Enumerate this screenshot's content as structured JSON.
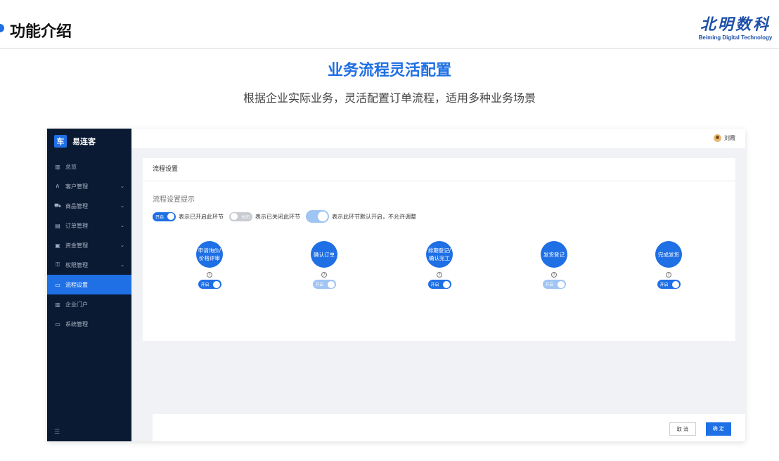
{
  "slide": {
    "section_title": "功能介绍",
    "logo_cn": "北明数科",
    "logo_en": "Beiming Digital Technology",
    "headline": "业务流程灵活配置",
    "subline": "根据企业实际业务，灵活配置订单流程，适用多种业务场景"
  },
  "app": {
    "brand_badge": "车",
    "brand_name": "易连客",
    "user_name": "刘霞",
    "sidebar": [
      {
        "label": "总览",
        "icon": "chart-icon",
        "expandable": false
      },
      {
        "label": "客户管理",
        "icon": "users-icon",
        "expandable": true
      },
      {
        "label": "商品管理",
        "icon": "cart-icon",
        "expandable": true
      },
      {
        "label": "订单管理",
        "icon": "document-icon",
        "expandable": true
      },
      {
        "label": "资金管理",
        "icon": "wallet-icon",
        "expandable": true
      },
      {
        "label": "权限管理",
        "icon": "lock-icon",
        "expandable": true
      },
      {
        "label": "流程设置",
        "icon": "monitor-icon",
        "expandable": false,
        "active": true
      },
      {
        "label": "企业门户",
        "icon": "chart-icon",
        "expandable": false
      },
      {
        "label": "系统管理",
        "icon": "monitor-icon",
        "expandable": false
      }
    ],
    "card_title": "流程设置",
    "hint_title": "流程设置提示",
    "legend": {
      "on_switch": "开启",
      "on_text": "表示已开启此环节",
      "off_switch": "关闭",
      "off_text": "表示已关闭此环节",
      "locked_text": "表示此环节默认开启，不允许调整"
    },
    "steps": [
      {
        "line1": "申请询价/",
        "line2": "价格评审",
        "switch": "开启",
        "state": "on"
      },
      {
        "line1": "确认订单",
        "line2": "",
        "switch": "开启",
        "state": "locked"
      },
      {
        "line1": "排期登记/",
        "line2": "确认完工",
        "switch": "开启",
        "state": "on"
      },
      {
        "line1": "发货登记",
        "line2": "",
        "switch": "开启",
        "state": "locked"
      },
      {
        "line1": "完成发货",
        "line2": "",
        "switch": "开启",
        "state": "on"
      }
    ],
    "help_glyph": "?",
    "cancel_label": "取 消",
    "ok_label": "确 定",
    "collapse_glyph": "☰"
  },
  "colors": {
    "accent": "#1f6fe5",
    "sidebar_bg": "#0b1a33",
    "switch_locked": "#a0c4f3",
    "switch_off": "#c8cbd1"
  }
}
